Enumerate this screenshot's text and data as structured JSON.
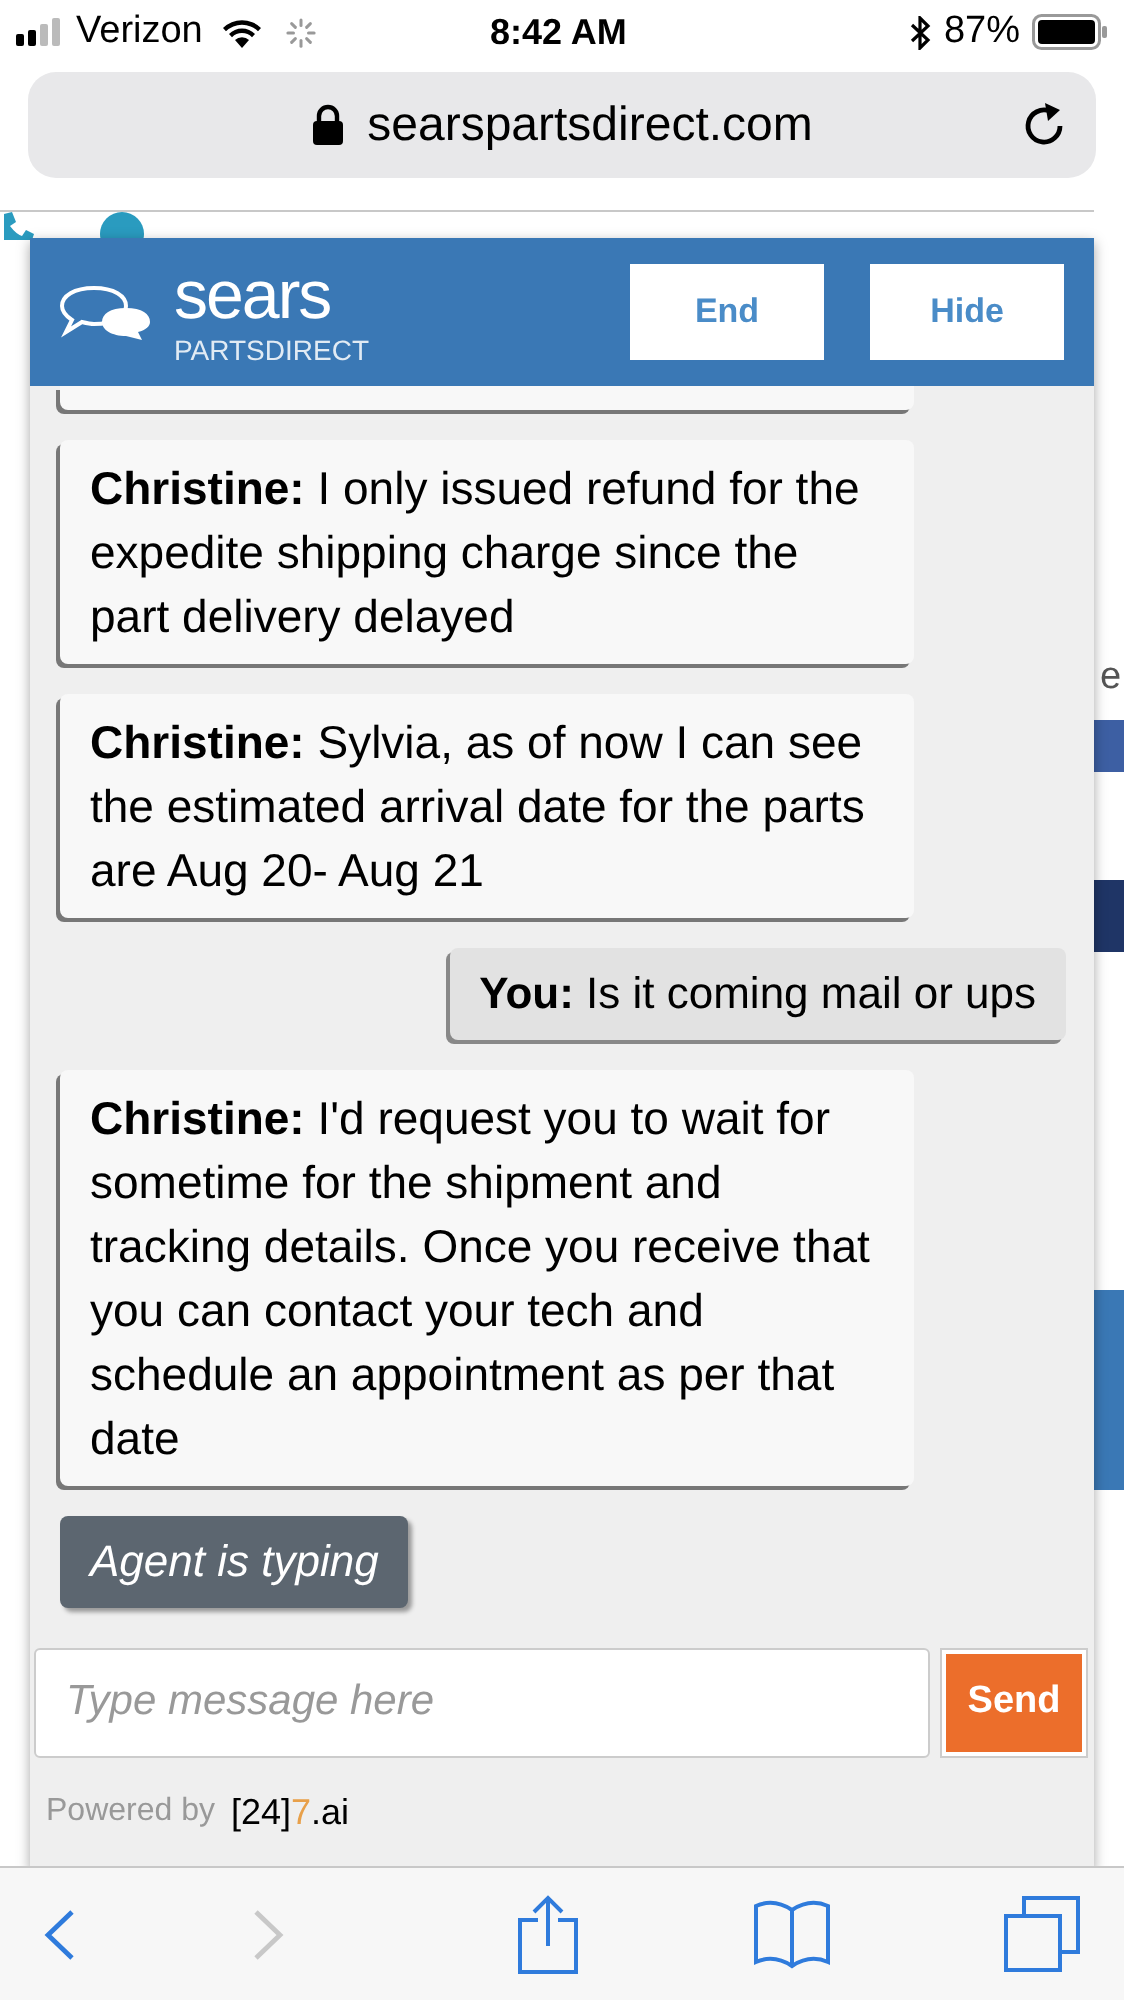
{
  "status_bar": {
    "carrier": "Verizon",
    "time": "8:42 AM",
    "battery": "87%"
  },
  "address_bar": {
    "url": "searspartsdirect.com"
  },
  "page_behind": {
    "fragments": [
      "e"
    ]
  },
  "chat": {
    "brand": {
      "name": "sears",
      "tagline": "PARTSDIRECT"
    },
    "buttons": [
      "End",
      "Hide"
    ],
    "messages": [
      {
        "kind": "agent",
        "text": "**Christine:** I only issued refund for the expedite shipping charge since the part delivery delayed"
      },
      {
        "kind": "agent",
        "text": "**Christine:** Sylvia, as of now I can see the estimated arrival date for the parts are Aug 20- Aug 21"
      },
      {
        "kind": "user",
        "text": "**You:** Is it coming mail or ups"
      },
      {
        "kind": "agent",
        "text": "**Christine:** I'd request you to wait for sometime for the shipment and tracking details. Once you receive that you can contact your tech and schedule an appointment as per that date"
      }
    ],
    "typing": "Agent is typing",
    "input": {
      "placeholder": "Type message here"
    },
    "send": "Send",
    "powered_by": {
      "label": "Powered by",
      "brand_parts": [
        "[24]",
        "7",
        ".ai"
      ]
    }
  }
}
